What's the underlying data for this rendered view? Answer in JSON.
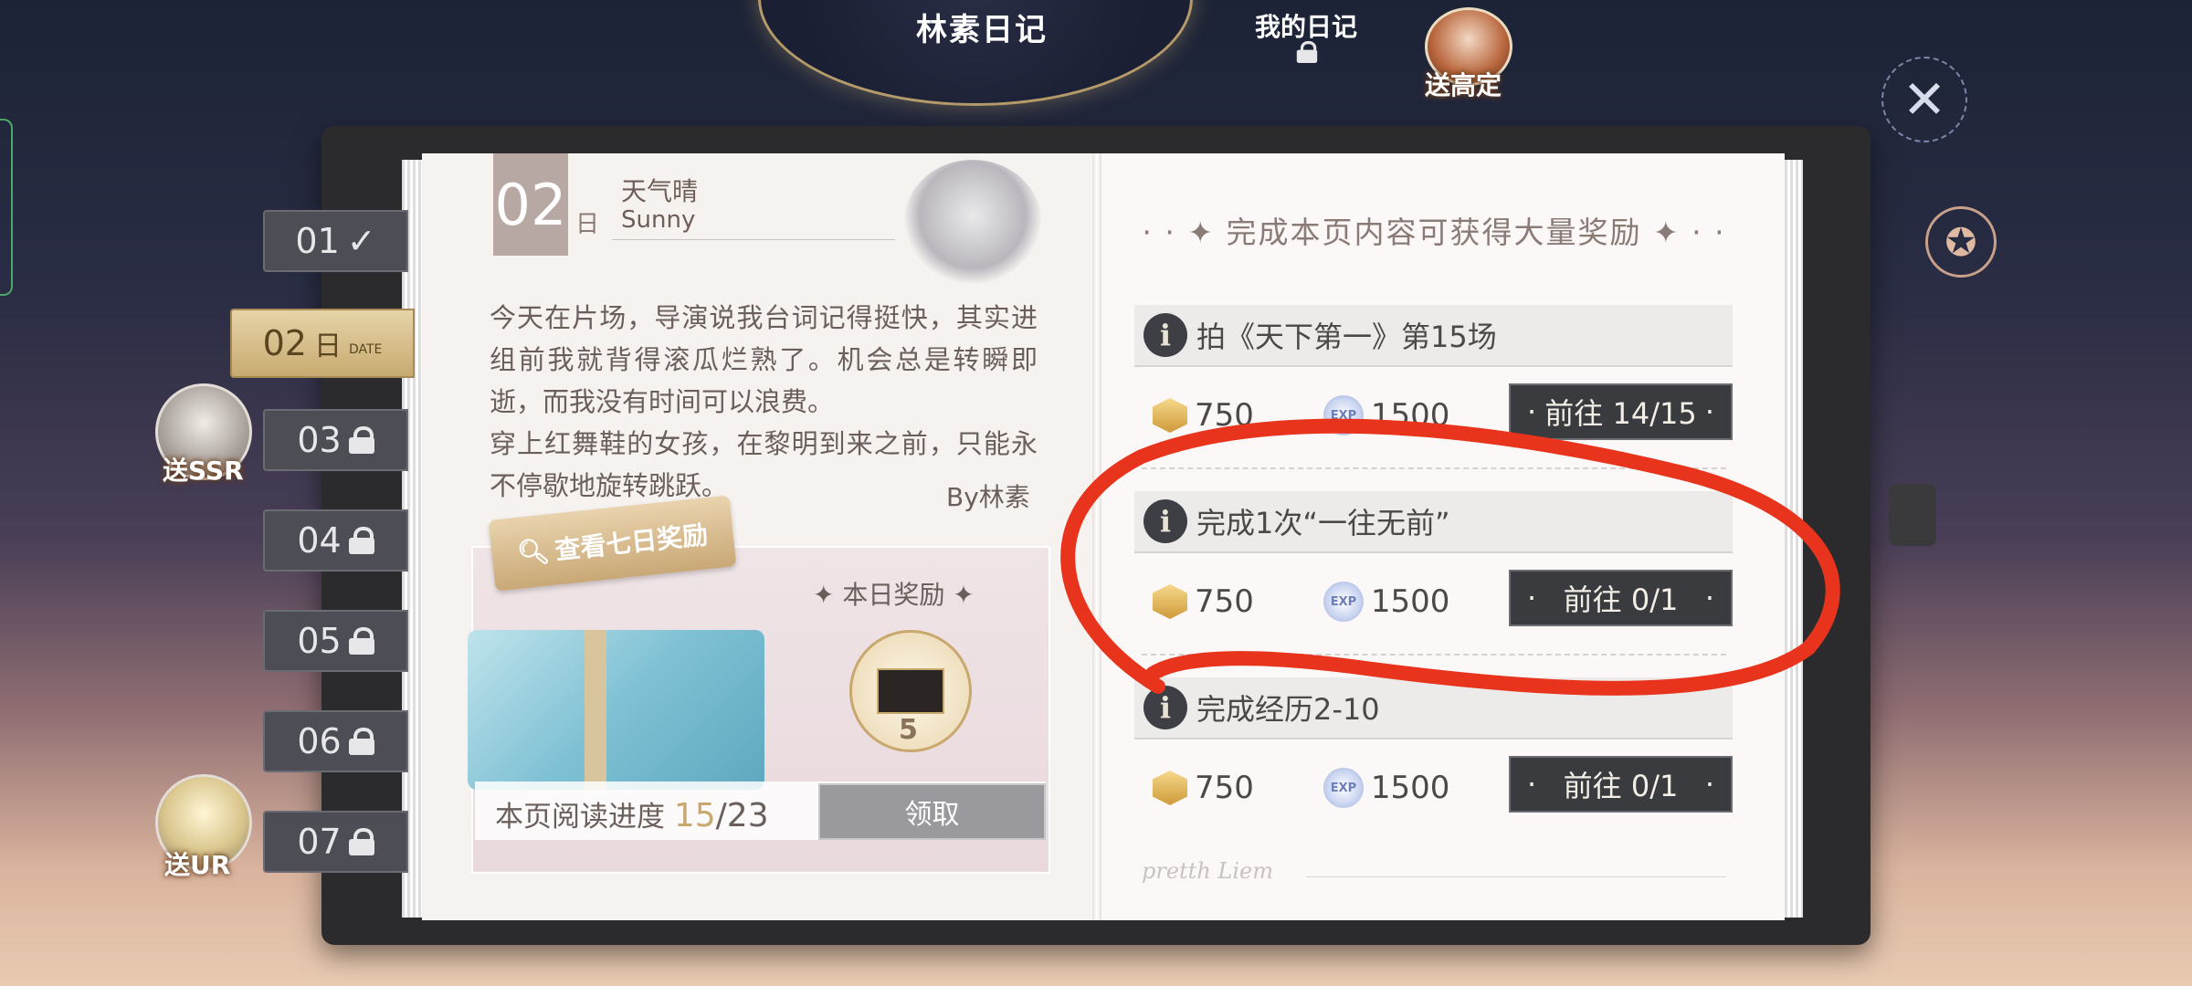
{
  "header": {
    "title": "林素日记",
    "my_diary": "我的日记",
    "gift_label": "送高定"
  },
  "side_badges": {
    "ssr_label": "送SSR",
    "ur_label": "送UR"
  },
  "tabs": [
    {
      "num": "01",
      "state": "done"
    },
    {
      "num": "02",
      "sub": "日",
      "date": "DATE",
      "state": "active"
    },
    {
      "num": "03",
      "state": "locked"
    },
    {
      "num": "04",
      "state": "locked"
    },
    {
      "num": "05",
      "state": "locked"
    },
    {
      "num": "06",
      "state": "locked"
    },
    {
      "num": "07",
      "state": "locked"
    }
  ],
  "diary": {
    "day": "02",
    "day_unit": "日",
    "weather_cn": "天气晴",
    "weather_en": "Sunny",
    "text": "今天在片场，导演说我台词记得挺快，其实进组前我就背得滚瓜烂熟了。机会总是转瞬即逝，而我没有时间可以浪费。\n穿上红舞鞋的女孩，在黎明到来之前，只能永不停歇地旋转跳跃。",
    "signature": "By林素"
  },
  "reward_card": {
    "tag_label": "查看七日奖励",
    "today_label": "本日奖励",
    "item_count": "5",
    "progress_label": "本页阅读进度",
    "progress_current": "15",
    "progress_total": "/23",
    "claim_label": "领取"
  },
  "right_page": {
    "header": "完成本页内容可获得大量奖励",
    "tasks": [
      {
        "title": "拍《天下第一》第15场",
        "coin": "750",
        "exp": "1500",
        "button": "前往 14/15"
      },
      {
        "title": "完成1次“一往无前”",
        "coin": "750",
        "exp": "1500",
        "button": "前往 0/1"
      },
      {
        "title": "完成经历2-10",
        "coin": "750",
        "exp": "1500",
        "button": "前往 0/1"
      }
    ],
    "signature": "pretth Liem"
  },
  "icons": {
    "close": "close-icon",
    "info": "i",
    "exp": "EXP"
  },
  "colors": {
    "annotation": "#e8341c",
    "gold": "#c9a86d"
  }
}
